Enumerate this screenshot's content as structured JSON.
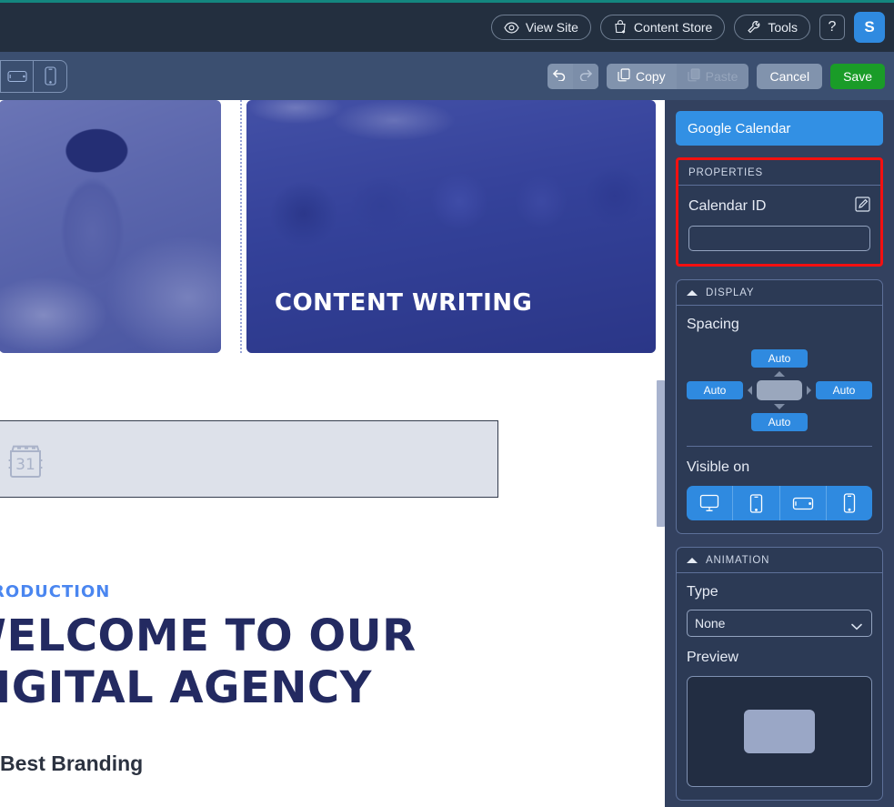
{
  "header": {
    "buttons": [
      {
        "label": "View Site",
        "icon": "eye-icon"
      },
      {
        "label": "Content Store",
        "icon": "store-add-icon"
      },
      {
        "label": "Tools",
        "icon": "wrench-icon"
      }
    ],
    "help_label": "?",
    "avatar_initial": "S",
    "accent_color": "#13867f",
    "background_color": "#232f3f"
  },
  "toolbar": {
    "devices": [
      {
        "name": "tablet-portrait",
        "active": false
      },
      {
        "name": "tablet-landscape",
        "active": false
      },
      {
        "name": "mobile",
        "active": false
      }
    ],
    "undo_label": "Undo",
    "redo_label": "Redo",
    "copy_label": "Copy",
    "paste_label": "Paste",
    "paste_disabled": true,
    "cancel_label": "Cancel",
    "save_label": "Save",
    "save_color": "#1a9c28",
    "background_color": "#3b4f70"
  },
  "canvas": {
    "cards": [
      {
        "label": "",
        "image": "man-wearing-vr-headset-at-desk"
      },
      {
        "label": "CONTENT WRITING",
        "image": "team-smiling-around-office-table"
      }
    ],
    "calendar_placeholder": {
      "icon": "calendar-31-icon",
      "day": "31"
    },
    "intro": {
      "eyebrow": "INTRODUCTION",
      "heading": "WELCOME TO OUR DIGITAL AGENCY",
      "subheading": "Best Branding",
      "eyebrow_color": "#4a86f0",
      "heading_color": "#232a61"
    }
  },
  "panel": {
    "widget_name": "Google Calendar",
    "widget_color": "#3290e4",
    "properties": {
      "section_label": "PROPERTIES",
      "highlight_color": "#f41010",
      "field_label": "Calendar ID",
      "field_value": "",
      "field_placeholder": "",
      "edit_icon": "pencil-square-icon"
    },
    "display": {
      "section_label": "DISPLAY",
      "spacing_label": "Spacing",
      "spacing": {
        "top": "Auto",
        "right": "Auto",
        "bottom": "Auto",
        "left": "Auto"
      },
      "visible_on_label": "Visible on",
      "visible_on": [
        {
          "device": "desktop",
          "active": true
        },
        {
          "device": "tablet-portrait",
          "active": true
        },
        {
          "device": "tablet-landscape",
          "active": true
        },
        {
          "device": "mobile",
          "active": true
        }
      ]
    },
    "animation": {
      "section_label": "ANIMATION",
      "type_label": "Type",
      "type_value": "None",
      "type_options": [
        "None"
      ],
      "preview_label": "Preview"
    }
  }
}
